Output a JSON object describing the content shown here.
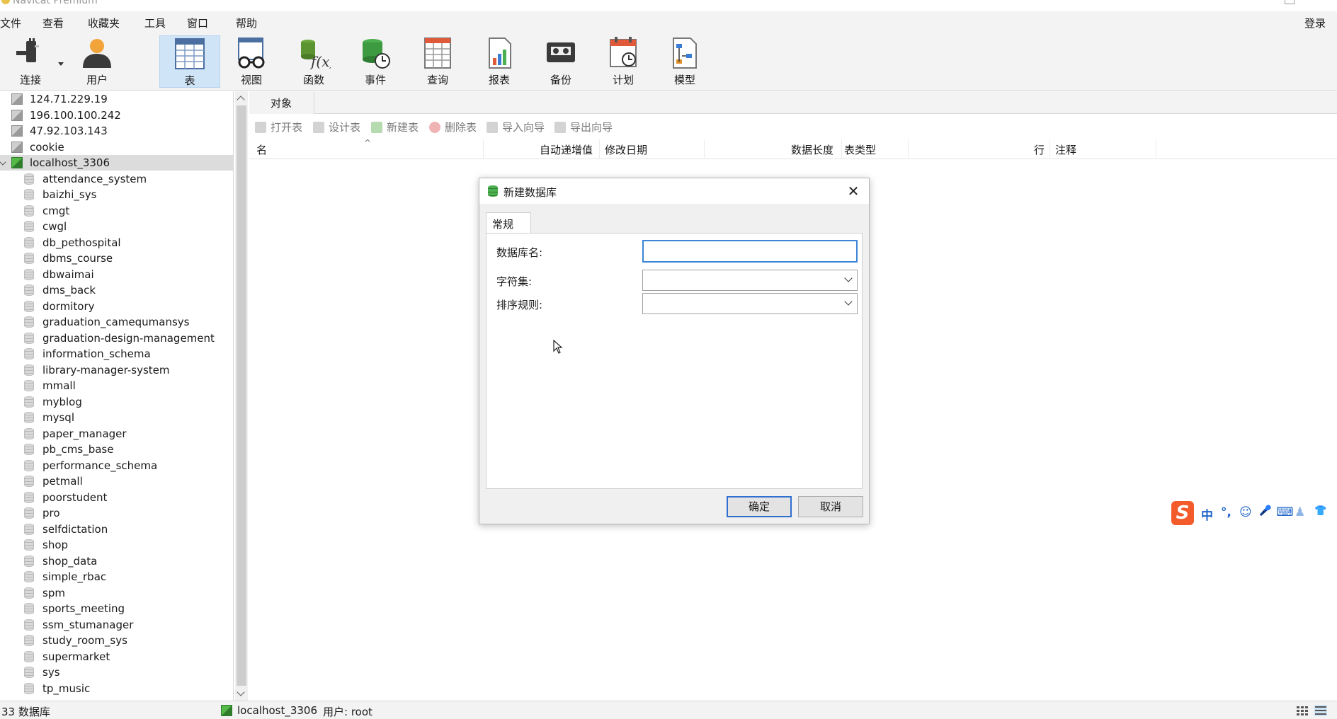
{
  "window": {
    "title": "Navicat Premium"
  },
  "menu": {
    "items": [
      "文件",
      "查看",
      "收藏夹",
      "工具",
      "窗口",
      "帮助"
    ],
    "login": "登录"
  },
  "toolbar": {
    "tools": [
      {
        "label": "连接",
        "icon": "connection-plug-icon"
      },
      {
        "label": "用户",
        "icon": "user-icon"
      },
      {
        "label": "表",
        "icon": "table-icon",
        "active": true
      },
      {
        "label": "视图",
        "icon": "view-glasses-icon"
      },
      {
        "label": "函数",
        "icon": "function-fx-icon"
      },
      {
        "label": "事件",
        "icon": "event-clock-icon"
      },
      {
        "label": "查询",
        "icon": "query-grid-icon"
      },
      {
        "label": "报表",
        "icon": "report-chart-icon"
      },
      {
        "label": "备份",
        "icon": "backup-tape-icon"
      },
      {
        "label": "计划",
        "icon": "schedule-calendar-icon"
      },
      {
        "label": "模型",
        "icon": "model-diagram-icon"
      }
    ]
  },
  "sidebar": {
    "connections": [
      "124.71.229.19",
      "196.100.100.242",
      "47.92.103.143",
      "cookie",
      "localhost_3306"
    ],
    "selected_connection": "localhost_3306",
    "databases": [
      "attendance_system",
      "baizhi_sys",
      "cmgt",
      "cwgl",
      "db_pethospital",
      "dbms_course",
      "dbwaimai",
      "dms_back",
      "dormitory",
      "graduation_camequmansys",
      "graduation-design-management",
      "information_schema",
      "library-manager-system",
      "mmall",
      "myblog",
      "mysql",
      "paper_manager",
      "pb_cms_base",
      "performance_schema",
      "petmall",
      "poorstudent",
      "pro",
      "selfdictation",
      "shop",
      "shop_data",
      "simple_rbac",
      "spm",
      "sports_meeting",
      "ssm_stumanager",
      "study_room_sys",
      "supermarket",
      "sys",
      "tp_music"
    ]
  },
  "main": {
    "tab_label": "对象",
    "actions": [
      "打开表",
      "设计表",
      "新建表",
      "删除表",
      "导入向导",
      "导出向导"
    ],
    "columns": [
      "名",
      "自动递增值",
      "修改日期",
      "数据长度",
      "表类型",
      "行",
      "注释"
    ]
  },
  "dialog": {
    "title": "新建数据库",
    "tab": "常规",
    "fields": {
      "dbname_label": "数据库名:",
      "dbname_value": "",
      "charset_label": "字符集:",
      "charset_value": "",
      "collation_label": "排序规则:",
      "collation_value": ""
    },
    "ok": "确定",
    "cancel": "取消"
  },
  "ime": {
    "items": [
      "中",
      "°,",
      "☺",
      "🎤",
      "⌨",
      "👕"
    ]
  },
  "status": {
    "count": "33 数据库",
    "connection": "localhost_3306",
    "user": "用户: root"
  },
  "colors": {
    "accent": "#3a85d6",
    "active_tool_bg": "#cfe4f7",
    "connection_green": "#2f7d2a",
    "ime_logo": "#f35b2b"
  }
}
